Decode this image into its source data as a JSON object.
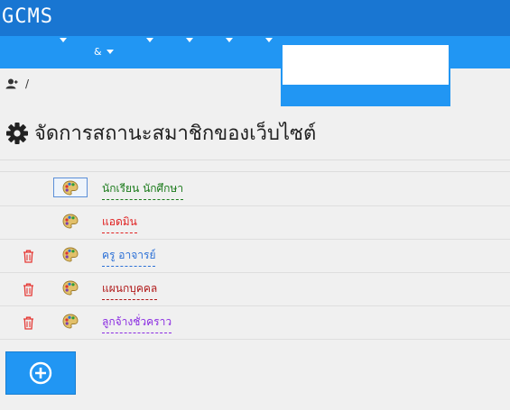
{
  "app": {
    "logo": "GCMS"
  },
  "nav": {
    "amp_label": "&",
    "carets": 6
  },
  "breadcrumb": {
    "separator": "/"
  },
  "page": {
    "title": "จัดการสถานะสมาชิกของเว็บไซต์"
  },
  "statuses": [
    {
      "label": "นักเรียน นักศึกษา",
      "color": "#1a7a1a",
      "deletable": false,
      "selected": true
    },
    {
      "label": "แอดมิน",
      "color": "#e02020",
      "deletable": false,
      "selected": false
    },
    {
      "label": "ครู อาจารย์",
      "color": "#2a6fd6",
      "deletable": true,
      "selected": false
    },
    {
      "label": "แผนกบุคคล",
      "color": "#b01818",
      "deletable": true,
      "selected": false
    },
    {
      "label": "ลูกจ้างชั่วคราว",
      "color": "#8a2be2",
      "deletable": true,
      "selected": false
    }
  ],
  "icons": {
    "trash": "trash-icon",
    "palette": "palette-icon",
    "add": "plus-circle-icon",
    "gear": "gear-icon",
    "user": "user-icon"
  },
  "colors": {
    "topbar": "#1976d2",
    "navbar": "#2196f3",
    "trash": "#e53935"
  }
}
